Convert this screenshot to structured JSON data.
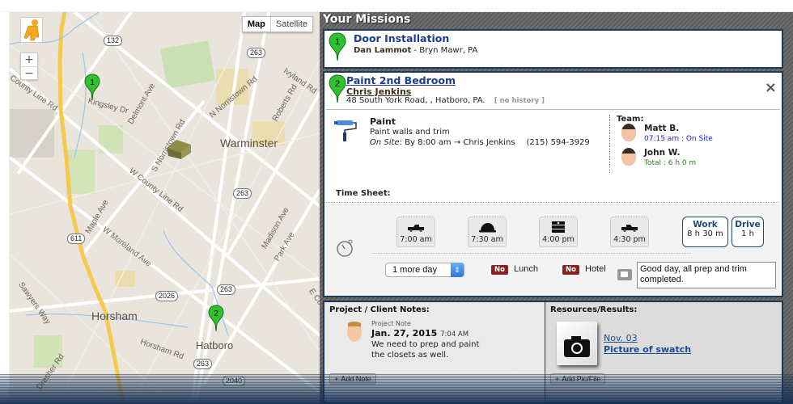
{
  "map": {
    "type_buttons": [
      "Map",
      "Satellite"
    ],
    "active_type": "Map",
    "zoom_in": "+",
    "zoom_out": "−",
    "towns": [
      "Warminster",
      "Horsham",
      "Hatboro"
    ],
    "roads": [
      "Kingsley Dr",
      "Delmont Ave",
      "S Norristown Rd",
      "N Norristown Rd",
      "W County Line Rd",
      "County Line Rd",
      "Maple Ave",
      "W Moreland Ave",
      "Madison Ave",
      "Park Ave",
      "Roberts Rd",
      "Ivyland Rd",
      "Horsham Rd",
      "Dresher Rd",
      "Sawyers Way",
      "E County Line Rd"
    ],
    "shields": [
      "132",
      "263",
      "263",
      "611",
      "263",
      "2026",
      "263",
      "2040"
    ],
    "markers": [
      {
        "label": "1"
      },
      {
        "label": "2"
      }
    ]
  },
  "panel": {
    "title": "Your Missions",
    "missions": [
      {
        "number": "1",
        "title": "Door Installation",
        "client": "Dan Lammot",
        "location": "- Bryn Mawr, PA"
      },
      {
        "number": "2",
        "title": "Paint 2nd Bedroom",
        "client": "Chris Jenkins",
        "address": "48 South York Road, , Hatboro, PA.",
        "history": "[ no history ]"
      }
    ],
    "close_icon": "×",
    "task": {
      "icon": "paint-roller-icon",
      "title": "Paint",
      "description": "Paint walls and trim",
      "onsite_label": "On Site",
      "onsite_text": ": By 8:00 am → Chris Jenkins",
      "phone": "(215) 594-3929"
    },
    "team": {
      "label": "Team:",
      "members": [
        {
          "name": "Matt B.",
          "status": "07:15 am : On Site",
          "status_color": "#1a1aff"
        },
        {
          "name": "John W.",
          "status": "Total : 6 h 0 m",
          "status_color": "#2e7d1e"
        }
      ]
    },
    "timesheet": {
      "label": "Time Sheet:",
      "entries": [
        {
          "icon": "truck-icon",
          "time": "7:00 am"
        },
        {
          "icon": "hard-hat-icon",
          "time": "7:30 am"
        },
        {
          "icon": "money-stack-icon",
          "time": "4:00 pm"
        },
        {
          "icon": "truck-icon",
          "time": "4:30 pm"
        }
      ],
      "work": {
        "label": "Work",
        "value": "8 h 30 m"
      },
      "drive": {
        "label": "Drive",
        "value": "1 h"
      },
      "more_days": "1 more day",
      "lunch": {
        "badge": "No",
        "label": "Lunch"
      },
      "hotel": {
        "badge": "No",
        "label": "Hotel"
      },
      "comment": "Good day, all prep and trim completed."
    },
    "notes": {
      "header": "Project / Client Notes:",
      "items": [
        {
          "type": "Project Note",
          "date": "Jan. 27, 2015",
          "time": "7:04 AM",
          "text": "We need to prep and paint the closets as well."
        }
      ],
      "add_label": "Add Note"
    },
    "resources": {
      "header": "Resources/Results:",
      "items": [
        {
          "date": "Nov. 03",
          "title": "Picture of swatch"
        }
      ],
      "add_label": "Add Pic/File"
    }
  }
}
